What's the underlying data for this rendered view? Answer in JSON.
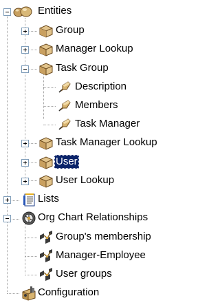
{
  "tree": {
    "root": {
      "label": "Entities",
      "icon": "beans-icon",
      "expanded": true
    },
    "entities": [
      {
        "label": "Group",
        "icon": "bean-icon",
        "expanded": false
      },
      {
        "label": "Manager Lookup",
        "icon": "bean-icon",
        "expanded": false
      },
      {
        "label": "Task Group",
        "icon": "bean-icon",
        "expanded": true,
        "children": [
          {
            "label": "Description",
            "icon": "field-icon"
          },
          {
            "label": "Members",
            "icon": "field-icon"
          },
          {
            "label": "Task Manager",
            "icon": "field-icon"
          }
        ]
      },
      {
        "label": "Task Manager Lookup",
        "icon": "bean-icon",
        "expanded": false
      },
      {
        "label": "User",
        "icon": "bean-icon",
        "expanded": false,
        "selected": true
      },
      {
        "label": "User Lookup",
        "icon": "bean-icon",
        "expanded": false
      }
    ],
    "lists": {
      "label": "Lists",
      "icon": "list-icon",
      "expanded": false
    },
    "org_chart": {
      "label": "Org Chart Relationships",
      "icon": "org-chart-icon",
      "expanded": true,
      "children": [
        {
          "label": "Group's membership",
          "icon": "relationship-icon"
        },
        {
          "label": "Manager-Employee",
          "icon": "relationship-icon"
        },
        {
          "label": "User groups",
          "icon": "relationship-icon"
        }
      ]
    },
    "configuration": {
      "label": "Configuration",
      "icon": "configuration-icon"
    }
  },
  "colors": {
    "selection": "#0a246a",
    "connector": "#a0a0a0",
    "expander_border": "#7f9db9"
  }
}
